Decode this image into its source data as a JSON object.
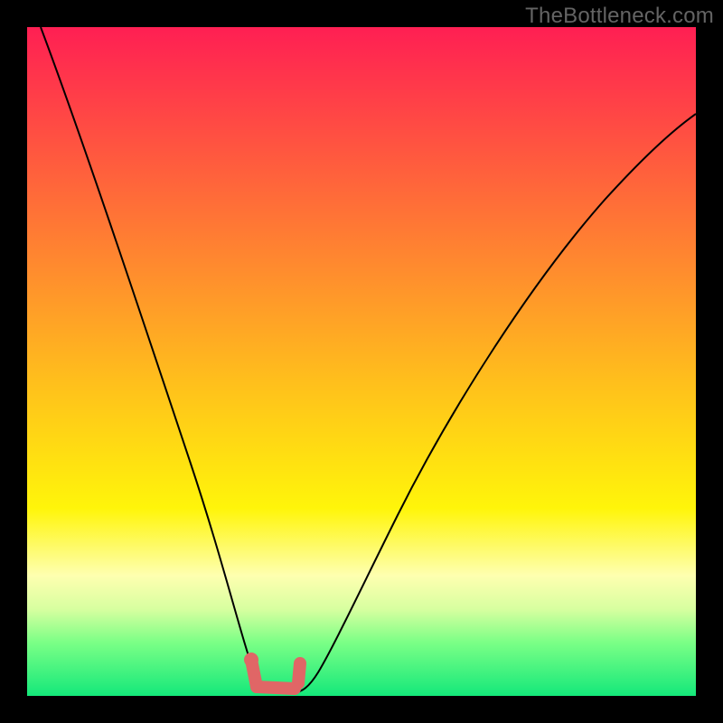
{
  "watermark": "TheBottleneck.com",
  "colors": {
    "background": "#000000",
    "gradient_top": "#ff1f53",
    "gradient_bottom": "#14e87a",
    "curve": "#000000",
    "marker": "#e06666"
  },
  "chart_data": {
    "type": "line",
    "title": "",
    "xlabel": "",
    "ylabel": "",
    "xlim": [
      0,
      100
    ],
    "ylim": [
      0,
      100
    ],
    "x": [
      2,
      5,
      8,
      11,
      14,
      17,
      20,
      23,
      26,
      28,
      30,
      32,
      34,
      35,
      37,
      40,
      43,
      46,
      50,
      55,
      60,
      65,
      70,
      75,
      80,
      85,
      90,
      95,
      100
    ],
    "y": [
      100,
      91,
      82,
      73,
      65,
      57,
      49,
      41,
      32,
      23,
      14,
      6,
      2,
      0,
      0,
      2,
      6,
      12,
      20,
      30,
      40,
      49,
      57,
      64,
      70,
      75,
      79,
      83,
      86
    ],
    "optimal_range_x": [
      32,
      40
    ],
    "optimal_y": 0,
    "annotations": []
  }
}
